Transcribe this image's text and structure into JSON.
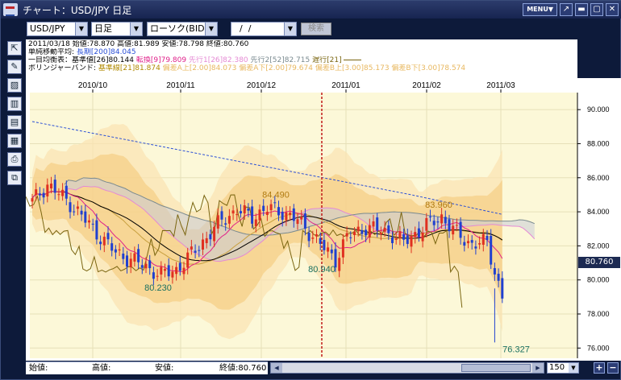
{
  "window": {
    "title": "チャート：USD/JPY 日足",
    "menu_label": "MENU▼",
    "buttons": [
      "↗",
      "▬",
      "▢",
      "✕"
    ]
  },
  "toolbar": {
    "pair": "USD/JPY",
    "period": "日足",
    "chart_type": "ローソク(BID)",
    "date": "  /  /",
    "search_label": "検索"
  },
  "info": {
    "ohlc_line": "2011/03/18  始値:78.870  高値:81.989  安値:78.798  終値:80.760",
    "sma_label": "単純移動平均:",
    "sma_value": "長期[200]84.045",
    "ichimoku_label": "一目均衡表：基準値[26]80.144",
    "ichimoku_tenkan": "転換[9]79.809",
    "ichimoku_senko1": "先行1[26]82.380",
    "ichimoku_senko2": "先行2[52]82.715",
    "ichimoku_chikou": "遅行[21]",
    "bb_label": "ボリンジャーバンド:",
    "bb_mid": "基準線[21]81.874",
    "bb_bands": "偏差A上[2.00]84.073  偏差A下[2.00]79.674  偏差B上[3.00]85.173  偏差B下[3.00]78.574"
  },
  "colors": {
    "sma": "#2a4fd6",
    "tenkan": "#e0208a",
    "kijun": "#000000",
    "senko1": "#e58ad4",
    "senko2": "#7a8a8f",
    "chikou": "#7a6510",
    "bb_fill_inner": "#f5c97a",
    "bb_fill_outer": "#fbe3b2",
    "chart_bg": "#fcf8d8",
    "up": "#e03020",
    "down": "#2040d0"
  },
  "chart_data": {
    "type": "candlestick",
    "x_tick_labels": [
      "2010/10",
      "2010/11",
      "2010/12",
      "2011/01",
      "2011/02",
      "2011/03"
    ],
    "y_tick_labels": [
      "90.000",
      "88.000",
      "86.000",
      "84.000",
      "82.000",
      "80.000",
      "78.000",
      "76.000"
    ],
    "ylim": [
      75.4,
      91.0
    ],
    "annotations": [
      "84.490",
      "83.960",
      "80.230",
      "80.940",
      "76.327"
    ],
    "current_price": "80.760"
  },
  "status": {
    "open": "始値:",
    "high": "高値:",
    "low": "安値:",
    "close": "終値:80.760"
  },
  "zoom": {
    "value": "150"
  }
}
